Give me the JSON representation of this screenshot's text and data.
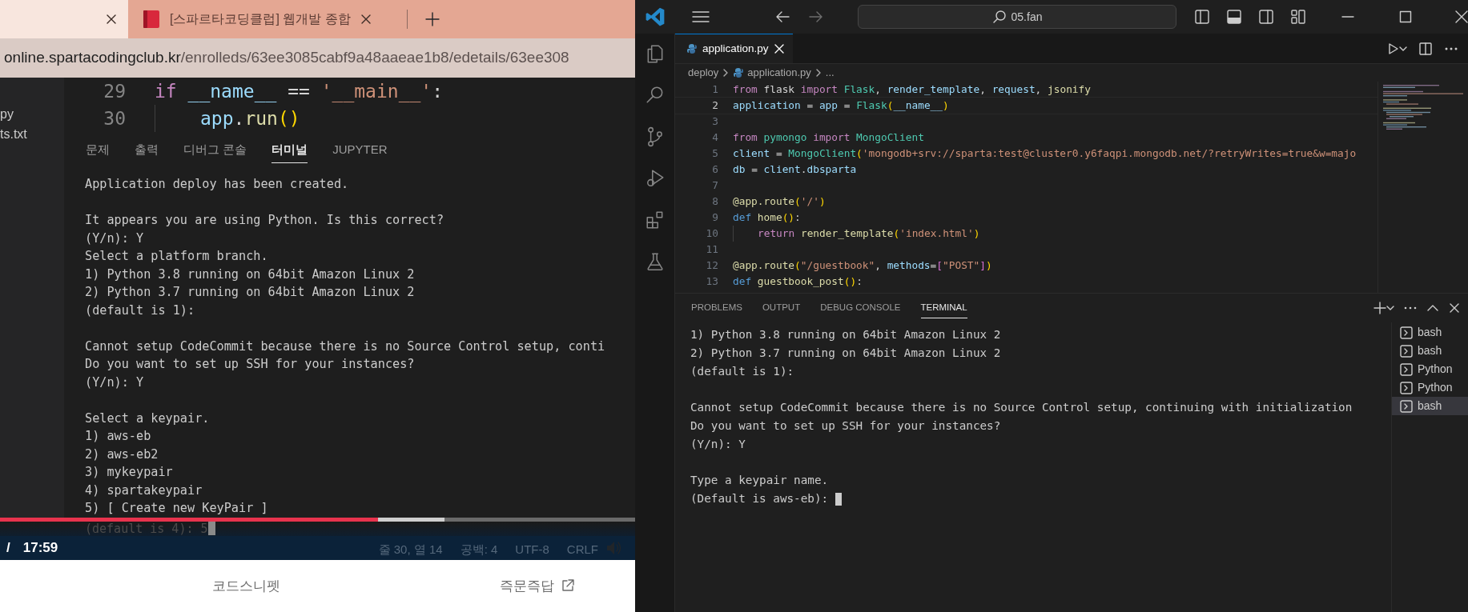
{
  "browser": {
    "tabs": [
      {
        "selected": true
      },
      {
        "title": "[스파르타코딩클럽] 웹개발 종합",
        "selected": false
      }
    ],
    "address": {
      "host": "online.spartacodingclub.kr",
      "path": "/enrolleds/63ee3085cabf9a48aaeae1b8/edetails/63ee308"
    },
    "video": {
      "explorer_items": [
        "py",
        "ts.txt"
      ],
      "editor_lines": [
        {
          "number": "29",
          "indented": false,
          "tokens": [
            {
              "text": "if",
              "kind": "keyword"
            },
            {
              "text": " __name__",
              "kind": "variable"
            },
            {
              "text": " == ",
              "kind": "plain"
            },
            {
              "text": "'__main__'",
              "kind": "string"
            },
            {
              "text": ":",
              "kind": "plain"
            }
          ]
        },
        {
          "number": "30",
          "indented": true,
          "tokens": [
            {
              "text": "app",
              "kind": "variable"
            },
            {
              "text": ".",
              "kind": "plain"
            },
            {
              "text": "run",
              "kind": "function"
            },
            {
              "text": "()",
              "kind": "bracket"
            }
          ]
        }
      ],
      "panel_tabs": [
        {
          "label": "문제",
          "selected": false
        },
        {
          "label": "출력",
          "selected": false
        },
        {
          "label": "디버그 콘솔",
          "selected": false
        },
        {
          "label": "터미널",
          "selected": true
        },
        {
          "label": "JUPYTER",
          "selected": false
        }
      ],
      "terminal_blocks": [
        [
          "Application deploy has been created."
        ],
        [
          "It appears you are using Python. Is this correct?",
          "(Y/n): Y",
          "Select a platform branch.",
          "1) Python 3.8 running on 64bit Amazon Linux 2",
          "2) Python 3.7 running on 64bit Amazon Linux 2",
          "(default is 1):"
        ],
        [
          "Cannot setup CodeCommit because there is no Source Control setup, conti",
          "Do you want to set up SSH for your instances?",
          "(Y/n): Y"
        ],
        [
          "Select a keypair.",
          "1) aws-eb",
          "2) aws-eb2",
          "3) mykeypair",
          "4) spartakeypair",
          "5) [ Create new KeyPair ]"
        ]
      ],
      "played": {
        "level": 0.595
      },
      "buffered": {
        "level": 0.7
      },
      "faded_line": "(default is 4): 5",
      "time_separator": "/",
      "duration": "17:59",
      "status_items": [
        "줄 30, 열 14",
        "공백: 4",
        "UTF-8",
        "CRLF"
      ]
    },
    "footer_links": [
      {
        "label": "코드스니펫",
        "external": false
      },
      {
        "label": "즉문즉답",
        "external": true
      }
    ]
  },
  "vscode": {
    "search": "05.fan",
    "editor_tab": {
      "label": "application.py",
      "selected": true
    },
    "breadcrumb": [
      {
        "label": "deploy",
        "kind": "folder"
      },
      {
        "label": "application.py",
        "kind": "file"
      },
      {
        "label": "...",
        "kind": "more"
      }
    ],
    "code_lines": [
      {
        "number": "1",
        "current": false,
        "indented": false,
        "tokens": [
          {
            "text": "from",
            "kind": "keyword"
          },
          {
            "text": " flask ",
            "kind": "plain"
          },
          {
            "text": "import",
            "kind": "keyword"
          },
          {
            "text": " Flask",
            "kind": "class"
          },
          {
            "text": ", ",
            "kind": "plain"
          },
          {
            "text": "render_template",
            "kind": "variable"
          },
          {
            "text": ", ",
            "kind": "plain"
          },
          {
            "text": "request",
            "kind": "variable"
          },
          {
            "text": ", ",
            "kind": "plain"
          },
          {
            "text": "jsonify",
            "kind": "function"
          }
        ]
      },
      {
        "number": "2",
        "current": true,
        "indented": false,
        "tokens": [
          {
            "text": "application",
            "kind": "variable"
          },
          {
            "text": " = ",
            "kind": "plain"
          },
          {
            "text": "app",
            "kind": "variable"
          },
          {
            "text": " = ",
            "kind": "plain"
          },
          {
            "text": "Flask",
            "kind": "class"
          },
          {
            "text": "(",
            "kind": "bracket"
          },
          {
            "text": "__name__",
            "kind": "variable"
          },
          {
            "text": ")",
            "kind": "bracket"
          }
        ]
      },
      {
        "number": "3",
        "current": false
      },
      {
        "number": "4",
        "current": false,
        "indented": false,
        "tokens": [
          {
            "text": "from",
            "kind": "keyword"
          },
          {
            "text": " pymongo",
            "kind": "class"
          },
          {
            "text": " import",
            "kind": "keyword"
          },
          {
            "text": " MongoClient",
            "kind": "class"
          }
        ]
      },
      {
        "number": "5",
        "current": false,
        "indented": false,
        "tokens": [
          {
            "text": "client",
            "kind": "variable"
          },
          {
            "text": " = ",
            "kind": "plain"
          },
          {
            "text": "MongoClient",
            "kind": "class"
          },
          {
            "text": "(",
            "kind": "bracket"
          },
          {
            "text": "'mongodb+srv://sparta:test@cluster0.y6faqpi.mongodb.net/?retryWrites=true&w=majo",
            "kind": "string"
          }
        ]
      },
      {
        "number": "6",
        "current": false,
        "indented": false,
        "tokens": [
          {
            "text": "db",
            "kind": "variable"
          },
          {
            "text": " = ",
            "kind": "plain"
          },
          {
            "text": "client",
            "kind": "variable"
          },
          {
            "text": ".",
            "kind": "plain"
          },
          {
            "text": "dbsparta",
            "kind": "variable"
          }
        ]
      },
      {
        "number": "7",
        "current": false
      },
      {
        "number": "8",
        "current": false,
        "indented": false,
        "tokens": [
          {
            "text": "@app.route",
            "kind": "function"
          },
          {
            "text": "(",
            "kind": "bracket"
          },
          {
            "text": "'/'",
            "kind": "string"
          },
          {
            "text": ")",
            "kind": "bracket"
          }
        ]
      },
      {
        "number": "9",
        "current": false,
        "indented": false,
        "tokens": [
          {
            "text": "def",
            "kind": "storage"
          },
          {
            "text": " home",
            "kind": "function"
          },
          {
            "text": "()",
            "kind": "bracket"
          },
          {
            "text": ":",
            "kind": "plain"
          }
        ]
      },
      {
        "number": "10",
        "current": false,
        "indented": true,
        "tokens": [
          {
            "text": "return",
            "kind": "keyword"
          },
          {
            "text": " render_template",
            "kind": "function"
          },
          {
            "text": "(",
            "kind": "bracket"
          },
          {
            "text": "'index.html'",
            "kind": "string"
          },
          {
            "text": ")",
            "kind": "bracket"
          }
        ]
      },
      {
        "number": "11",
        "current": false
      },
      {
        "number": "12",
        "current": false,
        "indented": false,
        "tokens": [
          {
            "text": "@app.route",
            "kind": "function"
          },
          {
            "text": "(",
            "kind": "bracket"
          },
          {
            "text": "\"/guestbook\"",
            "kind": "string"
          },
          {
            "text": ", ",
            "kind": "plain"
          },
          {
            "text": "methods",
            "kind": "variable"
          },
          {
            "text": "=",
            "kind": "plain"
          },
          {
            "text": "[",
            "kind": "bracket2"
          },
          {
            "text": "\"POST\"",
            "kind": "string"
          },
          {
            "text": "]",
            "kind": "bracket2"
          },
          {
            "text": ")",
            "kind": "bracket"
          }
        ]
      },
      {
        "number": "13",
        "current": false,
        "indented": false,
        "tokens": [
          {
            "text": "def",
            "kind": "storage"
          },
          {
            "text": " guestbook_post",
            "kind": "function"
          },
          {
            "text": "()",
            "kind": "bracket"
          },
          {
            "text": ":",
            "kind": "plain"
          }
        ]
      }
    ],
    "panel_tabs": [
      {
        "label": "PROBLEMS",
        "selected": false
      },
      {
        "label": "OUTPUT",
        "selected": false
      },
      {
        "label": "DEBUG CONSOLE",
        "selected": false
      },
      {
        "label": "TERMINAL",
        "selected": true
      }
    ],
    "terminal_blocks": [
      [
        "1) Python 3.8 running on 64bit Amazon Linux 2",
        "2) Python 3.7 running on 64bit Amazon Linux 2",
        "(default is 1):"
      ],
      [
        "Cannot setup CodeCommit because there is no Source Control setup, continuing with initialization",
        "Do you want to set up SSH for your instances?",
        "(Y/n): Y"
      ],
      [
        "Type a keypair name.",
        "(Default is aws-eb):"
      ]
    ],
    "terminals": [
      {
        "name": "bash",
        "selected": false
      },
      {
        "name": "bash",
        "selected": false
      },
      {
        "name": "Python",
        "selected": false
      },
      {
        "name": "Python",
        "selected": false
      },
      {
        "name": "bash",
        "selected": true
      }
    ]
  }
}
